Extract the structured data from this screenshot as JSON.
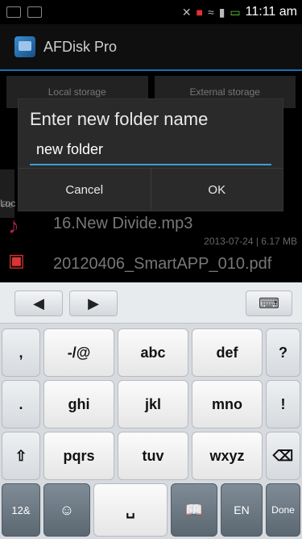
{
  "status_bar": {
    "time": "11:11 am",
    "icons": [
      "sd-icon",
      "image-icon",
      "mute-icon",
      "notif-icon",
      "wifi-icon",
      "signal-icon",
      "battery-icon"
    ]
  },
  "app": {
    "title": "AFDisk Pro"
  },
  "background": {
    "tabs": [
      "Local storage",
      "External storage"
    ],
    "side_hint": "Re",
    "locate_text": "Loc",
    "files": [
      {
        "name": "16.New Divide.mp3",
        "meta": "2013-07-24 | 6.17 MB"
      },
      {
        "name": "20120406_SmartAPP_010.pdf",
        "meta": ""
      }
    ]
  },
  "dialog": {
    "title": "Enter new folder name",
    "input_value": "new folder",
    "buttons": {
      "cancel": "Cancel",
      "ok": "OK"
    }
  },
  "keyboard": {
    "rows": [
      [
        ",",
        "-/@",
        "abc",
        "def",
        "?"
      ],
      [
        ".",
        "ghi",
        "jkl",
        "mno",
        "!"
      ],
      [
        "⇧",
        "pqrs",
        "tuv",
        "wxyz",
        "⌫"
      ],
      [
        "12&",
        "☺",
        "␣",
        "📖",
        "EN",
        "Done"
      ]
    ],
    "labels": {
      "arrow_left": "◀",
      "arrow_right": "▶",
      "toggle": "⌨"
    }
  }
}
